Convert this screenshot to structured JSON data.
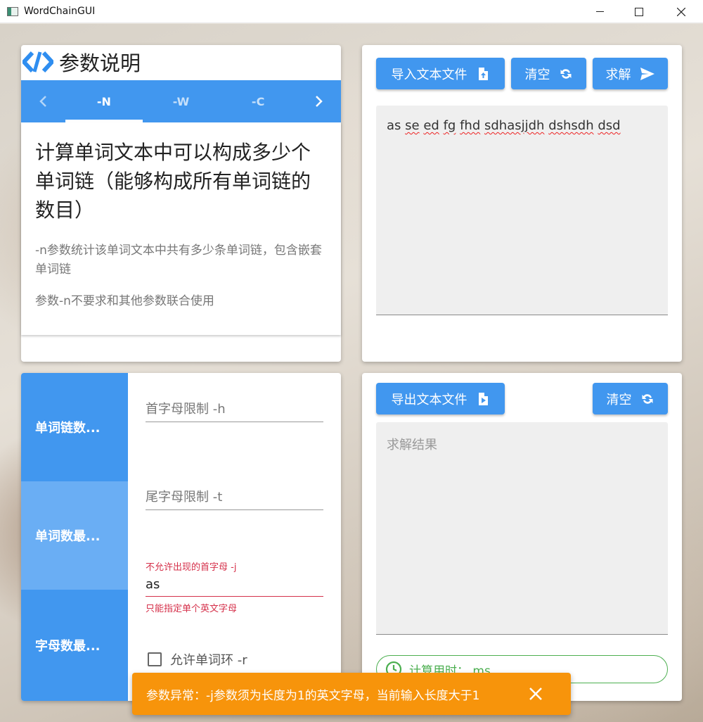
{
  "window": {
    "title": "WordChainGUI"
  },
  "params_card": {
    "title": "参数说明",
    "tabs": [
      "-N",
      "-W",
      "-C"
    ],
    "active_tab": "-N",
    "heading": "计算单词文本中可以构成多少个单词链（能够构成所有单词链的数目）",
    "desc1": "-n参数统计该单词文本中共有多少条单词链，包含嵌套单词链",
    "desc2": "参数-n不要求和其他参数联合使用"
  },
  "input_card": {
    "import_label": "导入文本文件",
    "clear_label": "清空",
    "solve_label": "求解",
    "text_words": [
      "as",
      "se",
      "ed",
      "fg",
      "fhd",
      "sdhasjjdh",
      "dshsdh",
      "dsd"
    ]
  },
  "options_card": {
    "side_tabs": [
      "单词链数...",
      "单词数最...",
      "字母数最..."
    ],
    "selected_side_tab": 1,
    "head_limit_placeholder": "首字母限制 -h",
    "tail_limit_placeholder": "尾字母限制 -t",
    "forbid_head_label": "不允许出现的首字母 -j",
    "forbid_head_value": "as",
    "forbid_head_error": "只能指定单个英文字母",
    "allow_cycle_label": "允许单词环 -r"
  },
  "output_card": {
    "export_label": "导出文本文件",
    "clear_label": "清空",
    "result_placeholder": "求解结果",
    "timer_text": "计算用时：  ms"
  },
  "snackbar": {
    "message": "参数异常：-j参数须为长度为1的英文字母，当前输入长度大于1"
  },
  "colors": {
    "primary": "#4197ef",
    "primary_light": "#6aaef4",
    "error": "#d5304a",
    "success": "#4caf50",
    "warning": "#f7940b"
  }
}
